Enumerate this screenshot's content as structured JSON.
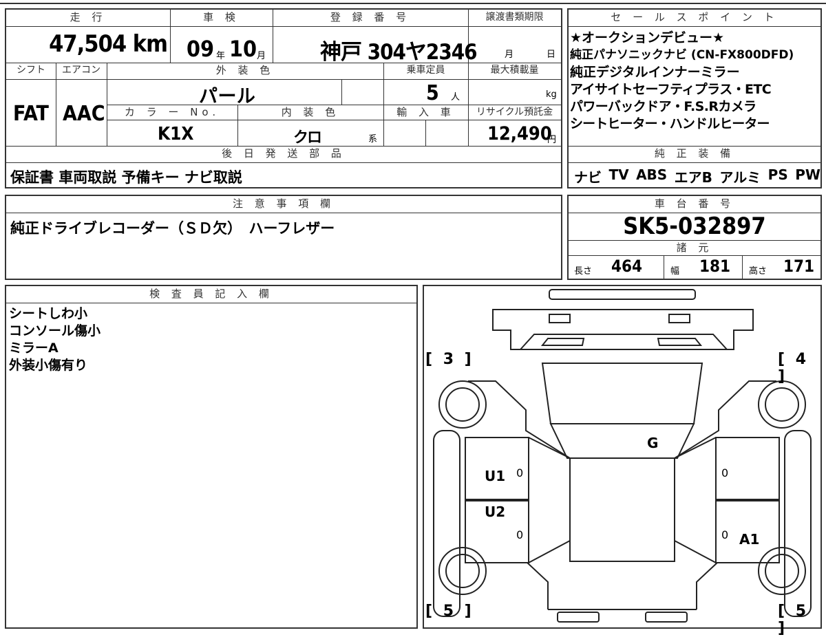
{
  "vehicle": {
    "mileage_header": "走 行",
    "mileage_value": "47,504 km",
    "inspection_header": "車 検",
    "inspection_year": "09",
    "inspection_year_unit": "年",
    "inspection_month": "10",
    "inspection_month_unit": "月",
    "registration_header": "登 録 番 号",
    "registration_value": "神戸 304ヤ2346",
    "transfer_header": "譲渡書類期限",
    "transfer_month_unit": "月",
    "transfer_day_unit": "日",
    "shift_header": "シフト",
    "shift_value": "FAT",
    "aircon_header": "エアコン",
    "aircon_value": "AAC",
    "exterior_header": "外 装 色",
    "exterior_value": "パ ー ル",
    "capacity_header": "乗車定員",
    "capacity_value": "5",
    "capacity_unit": "人",
    "maxload_header": "最大積載量",
    "maxload_unit": "kg",
    "colorno_header": "カ ラ ー No.",
    "colorno_value": "K1X",
    "interior_header": "内 装 色",
    "interior_value": "クロ",
    "interior_unit": "系",
    "import_header": "輸 入 車",
    "recycle_header": "リサイクル預託金",
    "recycle_value": "12,490",
    "recycle_unit": "円",
    "later_parts_header": "後 日 発 送 部 品",
    "later_parts_value": "保証書 車両取説 予備キー ナビ取説"
  },
  "sales_points": {
    "header": "セ ー ル ス ポ イ ン ト",
    "lines": [
      "★オークションデビュー★",
      "純正パナソニックナビ (CN-FX800DFD)",
      "純正デジタルインナーミラー",
      "アイサイトセーフティプラス・ETC",
      "パワーバックドア・F.S.Rカメラ",
      "シートヒーター・ハンドルヒーター"
    ]
  },
  "equipment": {
    "header": "純 正 装 備",
    "items": [
      "ナビ",
      "TV",
      "ABS",
      "エアB",
      "アルミ",
      "PS",
      "PW"
    ]
  },
  "notes": {
    "header": "注 意 事 項 欄",
    "value": "純正ドライブレコーダー（ＳＤ欠）　ハーフレザー"
  },
  "chassis": {
    "header": "車 台 番 号",
    "value": "SK5-032897"
  },
  "specs": {
    "header": "諸 元",
    "length_label": "長さ",
    "length_value": "464",
    "width_label": "幅",
    "width_value": "181",
    "height_label": "高さ",
    "height_value": "171"
  },
  "inspector": {
    "header": "検 査 員 記 入 欄",
    "lines": [
      "シートしわ小",
      "コンソール傷小",
      "ミラーA",
      "外装小傷有り"
    ]
  },
  "diagram": {
    "corner_tl": "[ 3 ]",
    "corner_tr": "[ 4 ]",
    "corner_bl": "[ 5 ]",
    "corner_br": "[ 5 ]",
    "mark_g": "G",
    "mark_u1": "U1",
    "mark_u2": "U2",
    "mark_a1": "A1",
    "zero_1": "0",
    "zero_2": "0",
    "zero_3": "0",
    "zero_4": "0"
  }
}
